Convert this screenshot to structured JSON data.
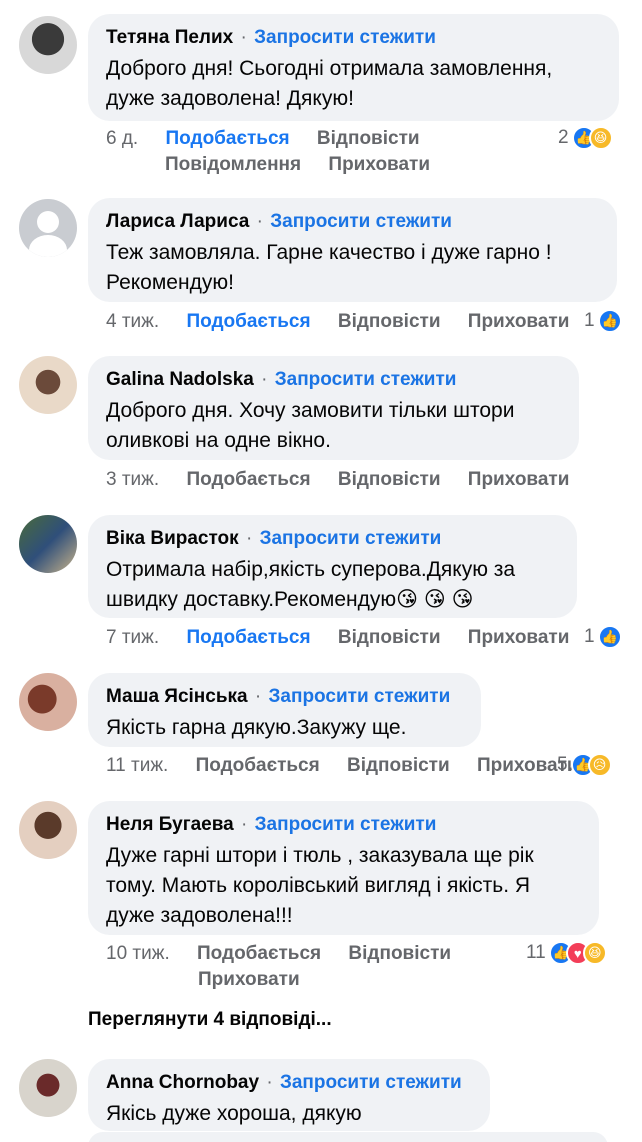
{
  "follow_label": "Запросити стежити",
  "separator": "·",
  "actions": {
    "like": "Подобається",
    "reply": "Відповісти",
    "message": "Повідомлення",
    "hide": "Приховати"
  },
  "comments": [
    {
      "author": "Тетяна Пелих",
      "line1": "Доброго дня! Сьогодні отримала замовлення,",
      "line2": "дуже задоволена! Дякую!",
      "time": "6 д.",
      "reaction_count": "2",
      "reaction_icons": [
        "like-icon",
        "haha-icon"
      ]
    },
    {
      "author": "Лариса Лариса",
      "line1": "Теж замовляла. Гарне качество і дуже гарно !",
      "line2": "Рекомендую!",
      "time": "4 тиж.",
      "reaction_count": "1",
      "reaction_icons": [
        "like-icon"
      ]
    },
    {
      "author": "Galina Nadolska",
      "line1": "Доброго дня. Хочу замовити тільки штори",
      "line2": "оливкові на одне вікно.",
      "time": "3 тиж."
    },
    {
      "author": "Віка Вирасток",
      "line1": "Отримала набір,якість суперова.Дякую за",
      "line2": "швидку доставку.Рекомендую😘 😘 😘",
      "time": "7 тиж.",
      "reaction_count": "1",
      "reaction_icons": [
        "like-icon"
      ]
    },
    {
      "author": "Маша Ясінська",
      "line1": "Якість гарна дякую.Закужу ще.",
      "time": "11 тиж.",
      "reaction_count": "5",
      "reaction_icons": [
        "like-icon",
        "sad-icon"
      ]
    },
    {
      "author": "Неля Бугаева",
      "line1": "Дуже гарні штори і тюль , заказувала ще рік",
      "line2": "тому.  Мають королівський вигляд і якість. Я",
      "line3": "дуже задоволена!!!",
      "time": "10 тиж.",
      "reaction_count": "11",
      "reaction_icons": [
        "like-icon",
        "love-icon",
        "haha-icon"
      ]
    },
    {
      "author": "Anna Chornobay",
      "line1": "Якісь дуже хороша, дякую"
    }
  ],
  "view_replies": "Переглянути 4 відповіді...",
  "colors": {
    "bubble": "#f0f2f5",
    "link_blue": "#1b74e4",
    "meta_gray": "#65676b",
    "like_blue": "#1877f2"
  }
}
